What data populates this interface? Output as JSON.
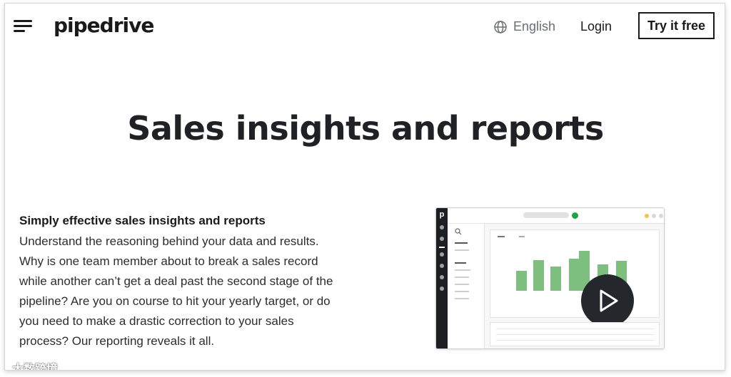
{
  "header": {
    "logo": "pipedrive",
    "language_label": "English",
    "login_label": "Login",
    "cta_label": "Try it free",
    "icons": {
      "menu": "hamburger-menu-icon",
      "language": "globe-icon"
    }
  },
  "hero": {
    "title": "Sales insights and reports"
  },
  "content": {
    "heading": "Simply effective sales insights and reports",
    "body": "Understand the reasoning behind your data and results. Why is one team member about to break a sales record while another can’t get a deal past the second stage of the pipeline? Are you on course to hit your yearly target, or do you need to make a drastic correction to your sales process? Our reporting reveals it all."
  },
  "preview": {
    "app_letter": "p",
    "video_action": "play-icon",
    "bar_levels": [
      0.45,
      0.7,
      0.55,
      0.72,
      0.9,
      0.6,
      0.68
    ],
    "bar_color": "#7cbf7f"
  },
  "watermark": {
    "text": "大数跨境"
  },
  "colors": {
    "text": "#1a1a1a",
    "muted": "#6b6f73",
    "accent_green": "#25a244"
  }
}
